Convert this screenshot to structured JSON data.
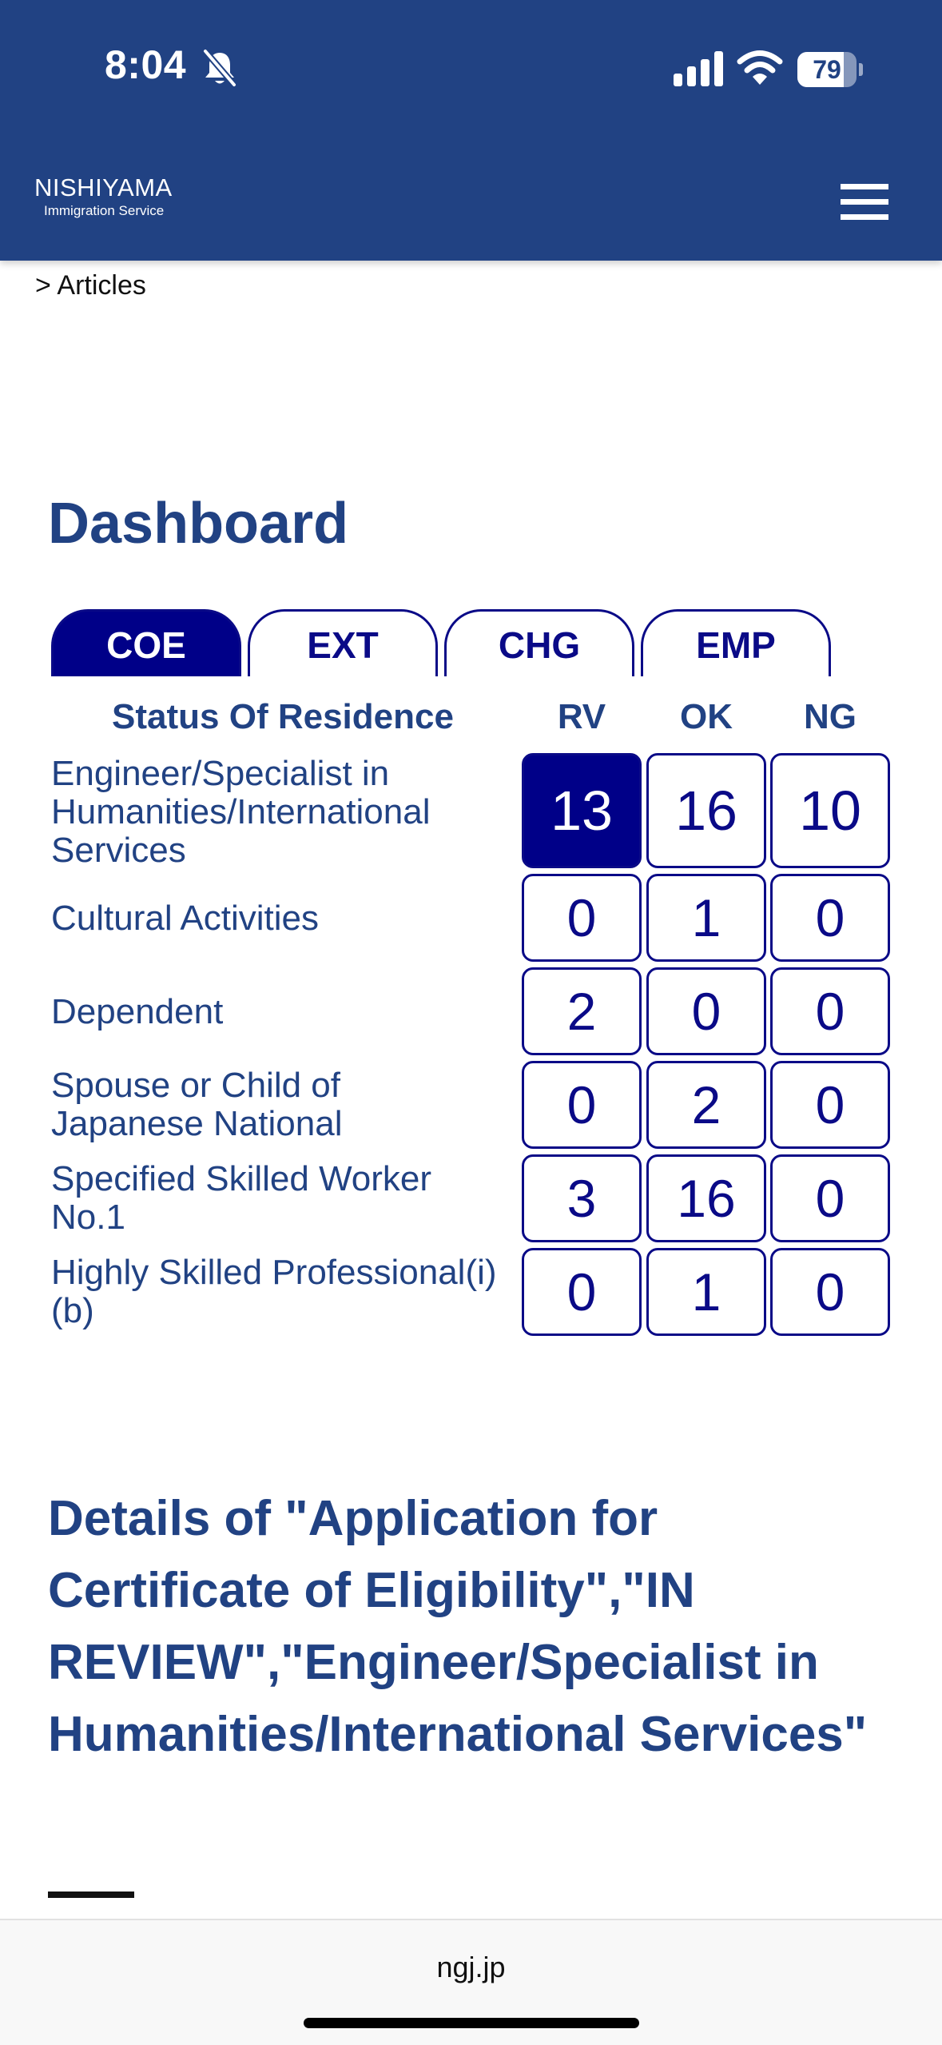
{
  "status_bar": {
    "time": "8:04",
    "battery": "79",
    "battery_level": 0.79,
    "icons": [
      "bell-slash-icon",
      "cellular-signal-icon",
      "wifi-icon",
      "battery-icon"
    ]
  },
  "header": {
    "logo_title": "NISHIYAMA",
    "logo_subtitle": "Immigration Service",
    "menu_icon": "hamburger-menu-icon"
  },
  "breadcrumb": "> Articles",
  "dashboard": {
    "title": "Dashboard",
    "tabs": [
      {
        "label": "COE",
        "active": true
      },
      {
        "label": "EXT",
        "active": false
      },
      {
        "label": "CHG",
        "active": false
      },
      {
        "label": "EMP",
        "active": false
      }
    ],
    "columns": {
      "status": "Status Of Residence",
      "rv": "RV",
      "ok": "OK",
      "ng": "NG"
    },
    "rows": [
      {
        "label": "Engineer/Specialist in Humanities/International Services",
        "rv": "13",
        "ok": "16",
        "ng": "10"
      },
      {
        "label": "Cultural Activities",
        "rv": "0",
        "ok": "1",
        "ng": "0"
      },
      {
        "label": "Dependent",
        "rv": "2",
        "ok": "0",
        "ng": "0"
      },
      {
        "label": "Spouse or Child of Japanese National",
        "rv": "0",
        "ok": "2",
        "ng": "0"
      },
      {
        "label": "Specified Skilled Worker No.1",
        "rv": "3",
        "ok": "16",
        "ng": "0"
      },
      {
        "label": "Highly Skilled Professional(i)(b)",
        "rv": "0",
        "ok": "1",
        "ng": "0"
      }
    ]
  },
  "details": {
    "title": "Details of \"Application for Certificate of Eligibility\",\"IN REVIEW\",\"Engineer/Specialist in Humanities/International Services\""
  },
  "browser": {
    "url": "ngj.jp"
  },
  "colors": {
    "header_bg": "#214283",
    "accent_navy": "#000088",
    "text_blue": "#214283"
  }
}
